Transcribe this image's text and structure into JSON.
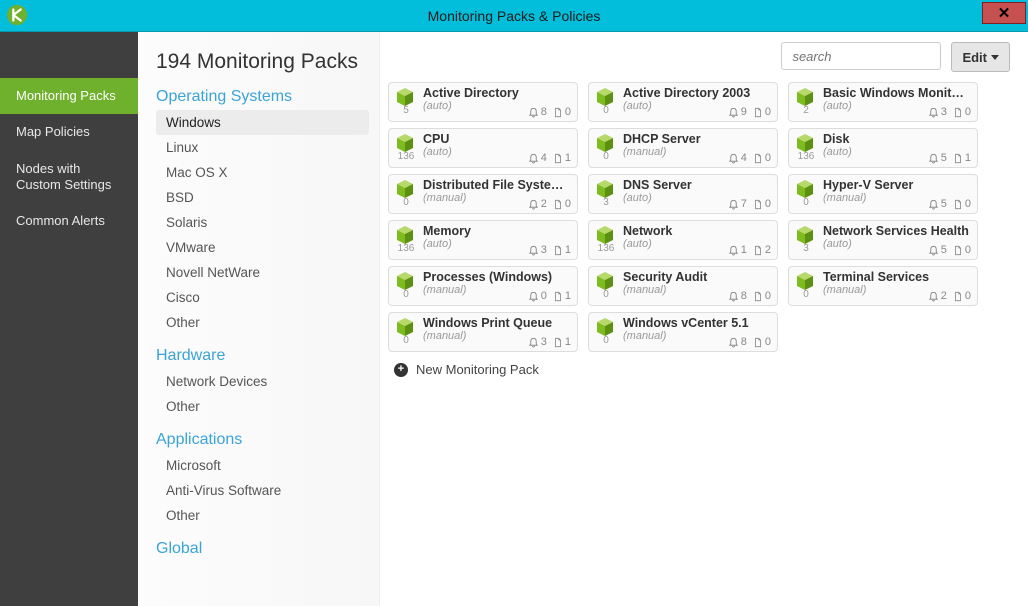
{
  "window": {
    "title": "Monitoring Packs & Policies"
  },
  "leftnav": {
    "items": [
      {
        "label": "Monitoring Packs",
        "active": true
      },
      {
        "label": "Map Policies"
      },
      {
        "label": "Nodes with Custom Settings",
        "multiline": true
      },
      {
        "label": "Common Alerts"
      }
    ]
  },
  "sidebar": {
    "heading": "194 Monitoring Packs",
    "groups": [
      {
        "title": "Operating Systems",
        "items": [
          "Windows",
          "Linux",
          "Mac OS X",
          "BSD",
          "Solaris",
          "VMware",
          "Novell NetWare",
          "Cisco",
          "Other"
        ],
        "activeIndex": 0
      },
      {
        "title": "Hardware",
        "items": [
          "Network Devices",
          "Other"
        ]
      },
      {
        "title": "Applications",
        "items": [
          "Microsoft",
          "Anti-Virus Software",
          "Other"
        ]
      },
      {
        "title": "Global",
        "items": []
      }
    ]
  },
  "toolbar": {
    "search_placeholder": "search",
    "edit_label": "Edit"
  },
  "packs": [
    {
      "name": "Active Directory",
      "count": "5",
      "mode": "(auto)",
      "alerts": "8",
      "docs": "0"
    },
    {
      "name": "Active Directory 2003",
      "count": "0",
      "mode": "(auto)",
      "alerts": "9",
      "docs": "0"
    },
    {
      "name": "Basic Windows Monitoring",
      "count": "2",
      "mode": "(auto)",
      "alerts": "3",
      "docs": "0"
    },
    {
      "name": "CPU",
      "count": "136",
      "mode": "(auto)",
      "alerts": "4",
      "docs": "1"
    },
    {
      "name": "DHCP Server",
      "count": "0",
      "mode": "(manual)",
      "alerts": "4",
      "docs": "0"
    },
    {
      "name": "Disk",
      "count": "136",
      "mode": "(auto)",
      "alerts": "5",
      "docs": "1"
    },
    {
      "name": "Distributed File System (D...",
      "count": "0",
      "mode": "(manual)",
      "alerts": "2",
      "docs": "0"
    },
    {
      "name": "DNS Server",
      "count": "3",
      "mode": "(auto)",
      "alerts": "7",
      "docs": "0"
    },
    {
      "name": "Hyper-V Server",
      "count": "0",
      "mode": "(manual)",
      "alerts": "5",
      "docs": "0"
    },
    {
      "name": "Memory",
      "count": "136",
      "mode": "(auto)",
      "alerts": "3",
      "docs": "1"
    },
    {
      "name": "Network",
      "count": "136",
      "mode": "(auto)",
      "alerts": "1",
      "docs": "2"
    },
    {
      "name": "Network Services Health",
      "count": "3",
      "mode": "(auto)",
      "alerts": "5",
      "docs": "0"
    },
    {
      "name": "Processes (Windows)",
      "count": "0",
      "mode": "(manual)",
      "alerts": "0",
      "docs": "1"
    },
    {
      "name": "Security Audit",
      "count": "0",
      "mode": "(manual)",
      "alerts": "8",
      "docs": "0"
    },
    {
      "name": "Terminal Services",
      "count": "0",
      "mode": "(manual)",
      "alerts": "2",
      "docs": "0"
    },
    {
      "name": "Windows Print Queue",
      "count": "0",
      "mode": "(manual)",
      "alerts": "3",
      "docs": "1"
    },
    {
      "name": "Windows vCenter 5.1",
      "count": "0",
      "mode": "(manual)",
      "alerts": "8",
      "docs": "0"
    }
  ],
  "newpack_label": "New Monitoring Pack",
  "icons": {
    "bell": "bell-icon",
    "doc": "document-icon"
  }
}
